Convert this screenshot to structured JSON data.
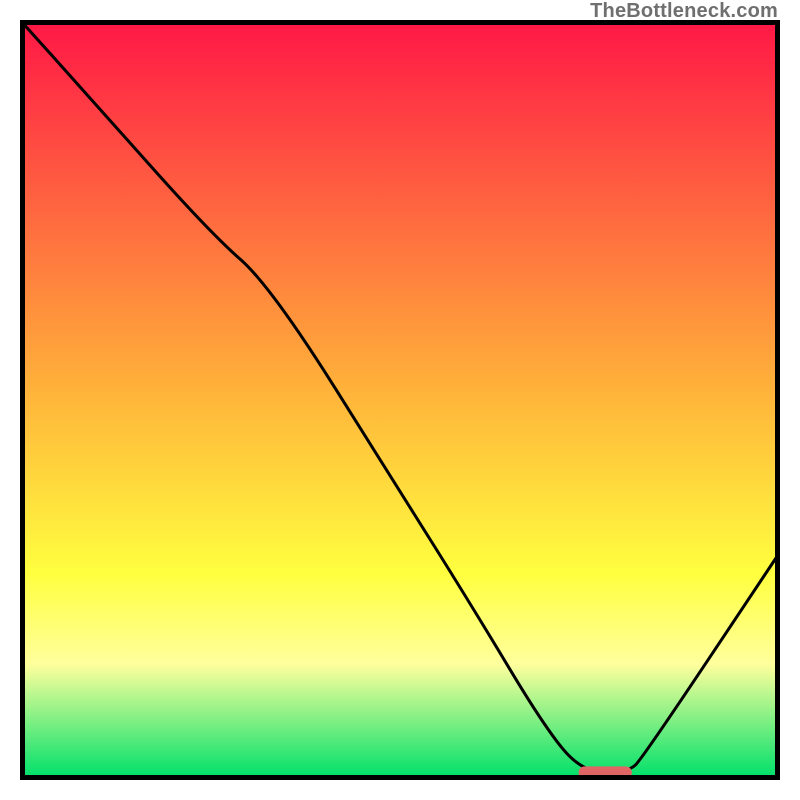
{
  "watermark": "TheBottleneck.com",
  "chart_data": {
    "type": "line",
    "title": "",
    "xlabel": "",
    "ylabel": "",
    "xlim": [
      0,
      100
    ],
    "ylim": [
      0,
      100
    ],
    "grid": false,
    "legend": false,
    "series": [
      {
        "name": "curve",
        "x": [
          0,
          9,
          25,
          33,
          50,
          60,
          69,
          74,
          80,
          82,
          100
        ],
        "y": [
          100,
          90,
          72,
          65,
          38,
          22,
          7,
          1,
          1,
          3,
          30
        ]
      }
    ],
    "marker": {
      "name": "optimal-range",
      "x_center": 77,
      "y": 1,
      "width": 7,
      "color": "#e06666"
    },
    "background_gradient": {
      "top_color": "#ff1846",
      "mid_color_1": "#ffb03a",
      "mid_color_2": "#ffff3f",
      "mid_color_3": "#ffff9d",
      "bottom_color": "#00e06a",
      "stops_pct": [
        0,
        48,
        73,
        85,
        100
      ]
    },
    "border_color": "#000000",
    "border_width": 5
  }
}
